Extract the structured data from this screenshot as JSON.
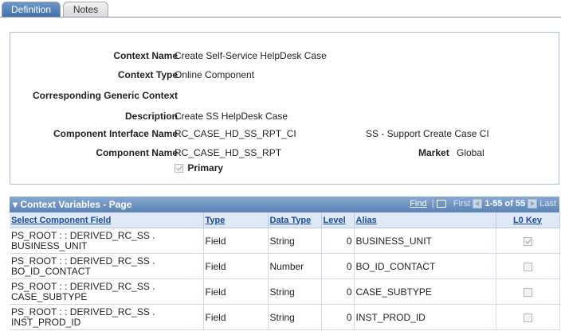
{
  "tabs": [
    {
      "label": "Definition",
      "active": true
    },
    {
      "label": "Notes",
      "active": false
    }
  ],
  "definition": {
    "context_name_label": "Context Name",
    "context_name_value": "Create Self-Service HelpDesk Case",
    "context_type_label": "Context Type",
    "context_type_value": "Online Component",
    "generic_context_label": "Corresponding Generic Context",
    "description_label": "Description",
    "description_value": "Create SS HelpDesk Case",
    "ci_label": "Component Interface Name",
    "ci_value": "RC_CASE_HD_SS_RPT_CI",
    "ci_description": "SS - Support Create Case CI",
    "component_label": "Component Name",
    "component_value": "RC_CASE_HD_SS_RPT",
    "market_label": "Market",
    "market_value": "Global",
    "primary_label": "Primary",
    "primary_checked": true
  },
  "grid": {
    "title": "Context Variables - Page",
    "find_label": "Find",
    "first_label": "First",
    "range_label": "1-55 of 55",
    "last_label": "Last",
    "columns": [
      "Select Component Field",
      "Type",
      "Data Type",
      "Level",
      "Alias",
      "L0 Key"
    ],
    "rows": [
      {
        "field1": "PS_ROOT : : DERIVED_RC_SS .",
        "field2": "BUSINESS_UNIT",
        "type": "Field",
        "data_type": "String",
        "level": "0",
        "alias": "BUSINESS_UNIT",
        "l0_key": true
      },
      {
        "field1": "PS_ROOT : : DERIVED_RC_SS .",
        "field2": "BO_ID_CONTACT",
        "type": "Field",
        "data_type": "Number",
        "level": "0",
        "alias": "BO_ID_CONTACT",
        "l0_key": false
      },
      {
        "field1": "PS_ROOT : : DERIVED_RC_SS .",
        "field2": "CASE_SUBTYPE",
        "type": "Field",
        "data_type": "String",
        "level": "0",
        "alias": "CASE_SUBTYPE",
        "l0_key": false
      },
      {
        "field1": "PS_ROOT : : DERIVED_RC_SS .",
        "field2": "INST_PROD_ID",
        "type": "Field",
        "data_type": "String",
        "level": "0",
        "alias": "INST_PROD_ID",
        "l0_key": false
      }
    ]
  }
}
